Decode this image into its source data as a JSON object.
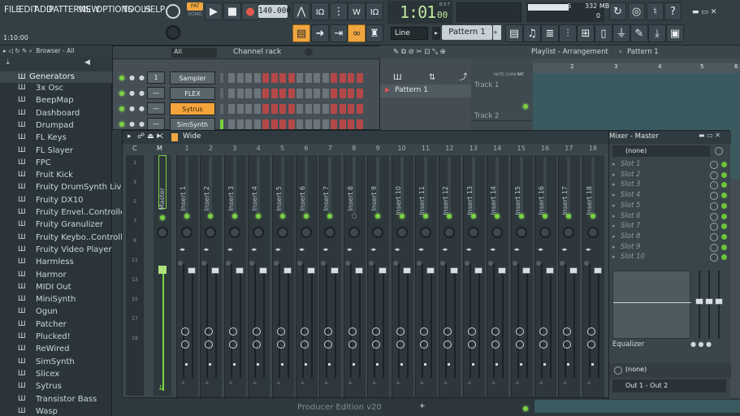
{
  "menu": [
    "FILE",
    "EDIT",
    "ADD",
    "PATTERNS",
    "VIEW",
    "OPTIONS",
    "TOOLS",
    "HELP"
  ],
  "transport": {
    "pat_label": "PAT",
    "song_label": "SONG",
    "tempo": "140.000",
    "time": "1:01",
    "time_sub": "00",
    "bst": "B:S:T",
    "hint_time": "1:10:00"
  },
  "cpu": {
    "value": "6",
    "memory": "332 MB",
    "zero": "0"
  },
  "toolbar2": {
    "snap": "Line",
    "pattern": "Pattern 1"
  },
  "browser": {
    "title": "Browser - All",
    "root": "Generators",
    "items": [
      "3x Osc",
      "BeepMap",
      "Dashboard",
      "Drumpad",
      "FL Keys",
      "FL Slayer",
      "FPC",
      "Fruit Kick",
      "Fruity DrumSynth Live",
      "Fruity DX10",
      "Fruity Envel..Controller",
      "Fruity Granulizer",
      "Fruity Keybo..Controller",
      "Fruity Video Player",
      "Harmless",
      "Harmor",
      "MIDI Out",
      "MiniSynth",
      "Ogun",
      "Patcher",
      "Plucked!",
      "ReWired",
      "SimSynth",
      "Slicex",
      "Sytrus",
      "Transistor Bass",
      "Wasp"
    ]
  },
  "channel_rack": {
    "filter": "All",
    "title": "Channel rack",
    "channels": [
      {
        "num": "1",
        "name": "Sampler"
      },
      {
        "num": "—",
        "name": "FLEX"
      },
      {
        "num": "—",
        "name": "Sytrus"
      },
      {
        "num": "—",
        "name": "SimSynth"
      }
    ]
  },
  "playlist": {
    "title": "Playlist - Arrangement",
    "pattern": "Pattern 1",
    "pattern_item": "Pattern 1",
    "tracks": [
      "Track 1",
      "Track 2"
    ],
    "ruler": [
      "2",
      "3",
      "4",
      "5",
      "6"
    ],
    "ruler_labels": [
      "MUTE",
      "CHAN",
      "PAT"
    ],
    "footer": "Producer Edition v20"
  },
  "mixer": {
    "title": "Mixer - Master",
    "view": "Wide",
    "c_label": "C",
    "m_label": "M",
    "master_label": "Master",
    "left_nums": [
      "1",
      "3",
      "5",
      "7",
      "9",
      "11",
      "13",
      "15",
      "17",
      "19"
    ],
    "numbers": [
      "1",
      "2",
      "3",
      "4",
      "5",
      "6",
      "7",
      "8",
      "9",
      "10",
      "11",
      "12",
      "13",
      "14",
      "15",
      "16",
      "17",
      "18"
    ],
    "inserts": [
      "Insert 1",
      "Insert 2",
      "Insert 3",
      "Insert 4",
      "Insert 5",
      "Insert 6",
      "Insert 7",
      "Insert 8",
      "Insert 9",
      "Insert 10",
      "Insert 11",
      "Insert 12",
      "Insert 13",
      "Insert 14",
      "Insert 15",
      "Insert 16",
      "Insert 17",
      "Insert 18"
    ],
    "preset": "(none)",
    "slots": [
      "Slot 1",
      "Slot 2",
      "Slot 3",
      "Slot 4",
      "Slot 5",
      "Slot 6",
      "Slot 7",
      "Slot 8",
      "Slot 9",
      "Slot 10"
    ],
    "eq_label": "Equalizer",
    "send": "(none)",
    "output": "Out 1 - Out 2"
  }
}
